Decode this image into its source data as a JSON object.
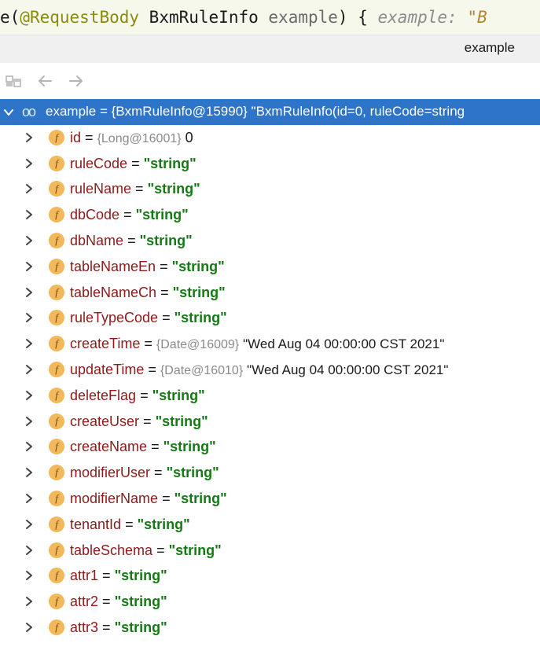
{
  "editor": {
    "prefix": "e(",
    "annotation": "@RequestBody",
    "class_name": "BxmRuleInfo",
    "param": "example",
    "suffix": ") {",
    "hint_name": "example:",
    "hint_value": "\"B"
  },
  "tab": {
    "title": "example"
  },
  "toolbar": {
    "icons": [
      "restore-layout-icon",
      "back-arrow-icon",
      "forward-arrow-icon"
    ]
  },
  "root": {
    "text": "example = {BxmRuleInfo@15990} \"BxmRuleInfo(id=0, ruleCode=string"
  },
  "fields": [
    {
      "name": "id",
      "eq": "=",
      "type": "{Long@16001}",
      "value": "0",
      "kind": "num"
    },
    {
      "name": "ruleCode",
      "eq": "=",
      "value": "\"string\"",
      "kind": "str"
    },
    {
      "name": "ruleName",
      "eq": "=",
      "value": "\"string\"",
      "kind": "str"
    },
    {
      "name": "dbCode",
      "eq": "=",
      "value": "\"string\"",
      "kind": "str"
    },
    {
      "name": "dbName",
      "eq": "=",
      "value": "\"string\"",
      "kind": "str"
    },
    {
      "name": "tableNameEn",
      "eq": "=",
      "value": "\"string\"",
      "kind": "str"
    },
    {
      "name": "tableNameCh",
      "eq": "=",
      "value": "\"string\"",
      "kind": "str"
    },
    {
      "name": "ruleTypeCode",
      "eq": "=",
      "value": "\"string\"",
      "kind": "str"
    },
    {
      "name": "createTime",
      "eq": "=",
      "type": "{Date@16009}",
      "value": "\"Wed Aug 04 00:00:00 CST 2021\"",
      "kind": "date"
    },
    {
      "name": "updateTime",
      "eq": "=",
      "type": "{Date@16010}",
      "value": "\"Wed Aug 04 00:00:00 CST 2021\"",
      "kind": "date"
    },
    {
      "name": "deleteFlag",
      "eq": "=",
      "value": "\"string\"",
      "kind": "str"
    },
    {
      "name": "createUser",
      "eq": "=",
      "value": "\"string\"",
      "kind": "str"
    },
    {
      "name": "createName",
      "eq": "=",
      "value": "\"string\"",
      "kind": "str"
    },
    {
      "name": "modifierUser",
      "eq": "=",
      "value": "\"string\"",
      "kind": "str"
    },
    {
      "name": "modifierName",
      "eq": "=",
      "value": "\"string\"",
      "kind": "str"
    },
    {
      "name": "tenantId",
      "eq": "=",
      "value": "\"string\"",
      "kind": "str"
    },
    {
      "name": "tableSchema",
      "eq": "=",
      "value": "\"string\"",
      "kind": "str"
    },
    {
      "name": "attr1",
      "eq": "=",
      "value": "\"string\"",
      "kind": "str"
    },
    {
      "name": "attr2",
      "eq": "=",
      "value": "\"string\"",
      "kind": "str"
    },
    {
      "name": "attr3",
      "eq": "=",
      "value": "\"string\"",
      "kind": "str"
    }
  ],
  "field_icon_letter": "f",
  "colors": {
    "selection": "#2e74c9",
    "field_name": "#8b1a1a",
    "string_value": "#157a15",
    "field_icon": "#f2b85a"
  }
}
